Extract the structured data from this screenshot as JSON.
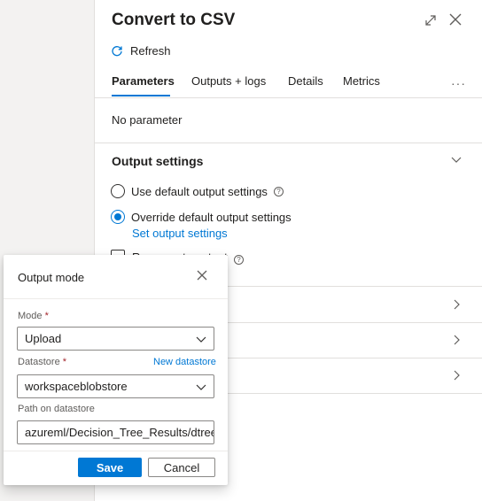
{
  "panel": {
    "title": "Convert to CSV",
    "refresh_label": "Refresh",
    "tabs": [
      {
        "label": "Parameters",
        "active": true
      },
      {
        "label": "Outputs + logs",
        "active": false
      },
      {
        "label": "Details",
        "active": false
      },
      {
        "label": "Metrics",
        "active": false
      }
    ],
    "more_label": "···",
    "no_parameter_text": "No parameter",
    "output_settings": {
      "title": "Output settings",
      "options": [
        {
          "label": "Use default output settings",
          "selected": false,
          "has_info": true
        },
        {
          "label": "Override default output settings",
          "selected": true,
          "has_info": false
        }
      ],
      "set_output_link": "Set output settings",
      "partial_text": "Regenerate output"
    }
  },
  "dialog": {
    "title": "Output mode",
    "mode": {
      "label": "Mode",
      "required_mark": "*",
      "value": "Upload"
    },
    "datastore": {
      "label": "Datastore",
      "required_mark": "*",
      "value": "workspaceblobstore",
      "new_link": "New datastore"
    },
    "path": {
      "label": "Path on datastore",
      "value": "azureml/Decision_Tree_Results/dtree_..."
    },
    "save_label": "Save",
    "cancel_label": "Cancel"
  },
  "colors": {
    "accent": "#0078d4",
    "required": "#a4262c",
    "background_left": "#f3f2f1"
  }
}
